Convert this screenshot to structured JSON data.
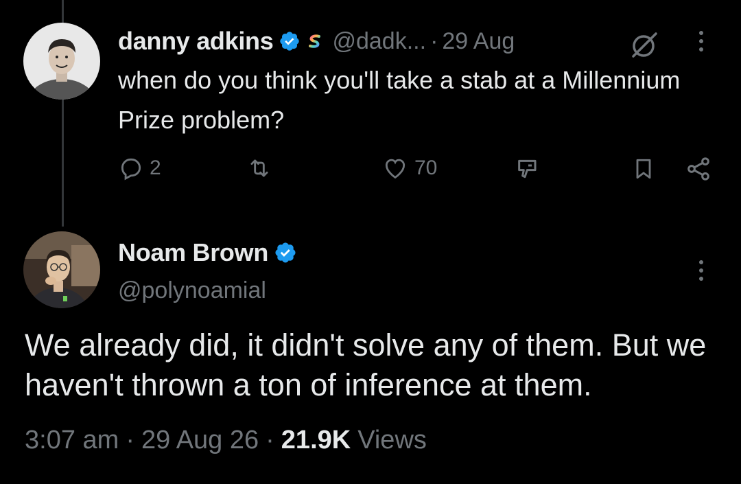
{
  "reply_tweet": {
    "author_name": "danny adkins",
    "handle": "@dadk...",
    "separator": "·",
    "date": "29 Aug",
    "text": "when do you think you'll take a stab at a Millennium Prize problem?",
    "actions": {
      "reply_count": "2",
      "retweet_count": "",
      "like_count": "70"
    }
  },
  "main_tweet": {
    "author_name": "Noam Brown",
    "handle": "@polynoamial",
    "text": "We already did, it didn't solve any of them. But we haven't thrown a ton of inference at them.",
    "time": "3:07 am",
    "date": "29 Aug 26",
    "views_count": "21.9K",
    "views_label": "Views",
    "sep": "·"
  },
  "icons": {
    "verified": "verified-badge-icon",
    "affiliate": "affiliate-badge-icon",
    "grok": "grok-icon",
    "more": "more-vertical-icon",
    "reply": "reply-icon",
    "retweet": "retweet-icon",
    "like": "heart-icon",
    "grok_action": "grok-action-icon",
    "bookmark": "bookmark-icon",
    "share": "share-icon"
  },
  "colors": {
    "background": "#000000",
    "text": "#e7e9ea",
    "secondary": "#71767b",
    "verified_blue": "#1d9bf0"
  }
}
